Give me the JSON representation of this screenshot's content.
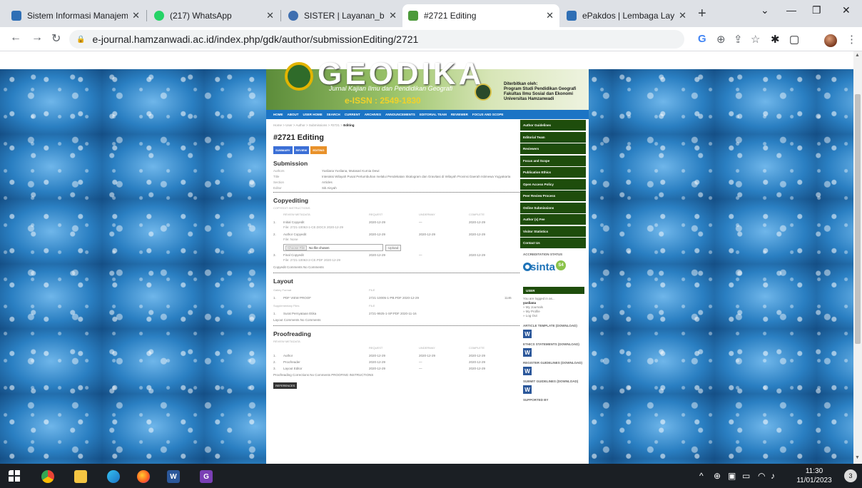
{
  "browser": {
    "tabs": [
      {
        "title": "Sistem Informasi Manajemen",
        "color": "#2f6fb5",
        "active": false
      },
      {
        "title": "(217) WhatsApp",
        "color": "#25d366",
        "active": false
      },
      {
        "title": "SISTER | Layanan_bkd",
        "color": "#3f6fb0",
        "active": false
      },
      {
        "title": "#2721 Editing",
        "color": "#4c9a3a",
        "active": true
      },
      {
        "title": "ePakdos | Lembaga Layanan",
        "color": "#2f6fb5",
        "active": false
      }
    ],
    "url": "e-journal.hamzanwadi.ac.id/index.php/gdk/author/submissionEditing/2721"
  },
  "banner": {
    "name": "GEODIKA",
    "tagline": "Jurnal Kajian Ilmu dan Pendidikan Geografi",
    "issn": "e-ISSN : 2549-1830",
    "publisher": [
      "Diterbitkan oleh:",
      "Program Studi Pendidikan Geografi",
      "Fakultas Ilmu Sosial dan Ekonomi",
      "Universitas Hamzanwadi"
    ]
  },
  "menu": [
    "HOME",
    "ABOUT",
    "USER HOME",
    "SEARCH",
    "CURRENT",
    "ARCHIVES",
    "ANNOUNCEMENTS",
    "EDITORIAL TEAM",
    "REVIEWER",
    "FOCUS AND SCOPE"
  ],
  "main": {
    "breadcrumb": {
      "path": "Home > User > Author > Submissions > #2721 >",
      "current": "Editing"
    },
    "title": "#2721 Editing",
    "buttons": [
      {
        "label": "SUMMARY",
        "color": "#3b6fd6"
      },
      {
        "label": "REVIEW",
        "color": "#3b6fd6"
      },
      {
        "label": "EDITING",
        "color": "#e8912a"
      }
    ],
    "submission": {
      "heading": "Submission",
      "fields": [
        {
          "k": "Authors",
          "v": "Yusliana Yusliana, Mutasari Kurnia Dewi"
        },
        {
          "k": "Title",
          "v": "Interaksi Wilayah Pusat Pertumbuhan melalui Pendekatan Skalogram dan Gravitasi di Wilayah Provinsi Daerah Istimewa Yogyakarta"
        },
        {
          "k": "Section",
          "v": "Articles"
        },
        {
          "k": "Editor",
          "v": "Siti Aisyah"
        }
      ]
    },
    "copyediting": {
      "heading": "Copyediting",
      "instructions": "COPYEDIT INSTRUCTIONS",
      "headers": [
        "REVIEW METADATA",
        "REQUEST",
        "UNDERWAY",
        "COMPLETE"
      ],
      "rows": [
        {
          "n": "1.",
          "name": "Initial Copyedit",
          "req": "2020-12-29",
          "und": "—",
          "comp": "2020-12-29",
          "file": "File: 2721-10063-1-CE.DOCX  2020-12-29"
        },
        {
          "n": "2.",
          "name": "Author Copyedit",
          "req": "2020-12-29",
          "und": "2020-12-29",
          "comp": "2020-12-29",
          "file": "File: None"
        },
        {
          "n": "3.",
          "name": "Final Copyedit",
          "req": "2020-12-29",
          "und": "—",
          "comp": "2020-12-29",
          "file": "File: 2721-10063-2-CE.PDF  2020-12-29"
        }
      ],
      "choose_file": "Choose File",
      "no_file": "No file chosen",
      "upload": "Upload",
      "comments": "Copyedit Comments  No Comments"
    },
    "layout": {
      "heading": "Layout",
      "galley_header": "Galley Format",
      "file_header": "FILE",
      "galley": {
        "n": "1.",
        "name": "PDF   VIEW PROOF",
        "file": "2721-10005-1-PB.PDF  2020-12-29",
        "count": "1146"
      },
      "supp_header": "Supplementary Files",
      "supp": {
        "n": "1.",
        "name": "Surat Pernyataan Etika",
        "file": "2721-9925-1-SP.PDF  2020-11-16"
      },
      "comments": "Layout Comments  No Comments"
    },
    "proofreading": {
      "heading": "Proofreading",
      "meta": "REVIEW METADATA",
      "headers": [
        "REQUEST",
        "UNDERWAY",
        "COMPLETE"
      ],
      "rows": [
        {
          "n": "1.",
          "name": "Author",
          "req": "2020-12-29",
          "und": "2020-12-29",
          "comp": "2020-12-29"
        },
        {
          "n": "2.",
          "name": "Proofreader",
          "req": "2020-12-29",
          "und": "—",
          "comp": "2020-12-29"
        },
        {
          "n": "3.",
          "name": "Layout Editor",
          "req": "2020-12-29",
          "und": "—",
          "comp": "2020-12-29"
        }
      ],
      "comments": "Proofreading Corrections  No Comments   PROOFING INSTRUCTIONS"
    },
    "refbtn": "REFERENCES"
  },
  "sidebar": {
    "items": [
      "Author Guidelines",
      "Editorial Team",
      "Reviewers",
      "Focus and Scope",
      "Publication Ethics",
      "Open Access Policy",
      "Peer Review Process",
      "Online Submissions",
      "Author (s) Fee",
      "Visitor Statistics",
      "Contact Us"
    ],
    "accreditation": "ACCREDITATION STATUS",
    "sinta": "sinta",
    "sinta_level": "S4",
    "user_box": "USER",
    "logged_in": "You are logged in as...",
    "username": "yusliana",
    "user_links": [
      "» My Journals",
      "» My Profile",
      "» Log Out"
    ],
    "downloads": [
      "ARTICLE TEMPLATE (DOWNLOAD)",
      "ETHICS STATEMENTS (DOWNLOAD)",
      "REGISTER GUIDELINES (DOWNLOAD)",
      "SUBMIT GUIDELINES (DOWNLOAD)"
    ],
    "supported": "SUPPORTED BY"
  },
  "taskbar": {
    "time": "11:30",
    "date": "11/01/2023",
    "notifications": "3"
  }
}
